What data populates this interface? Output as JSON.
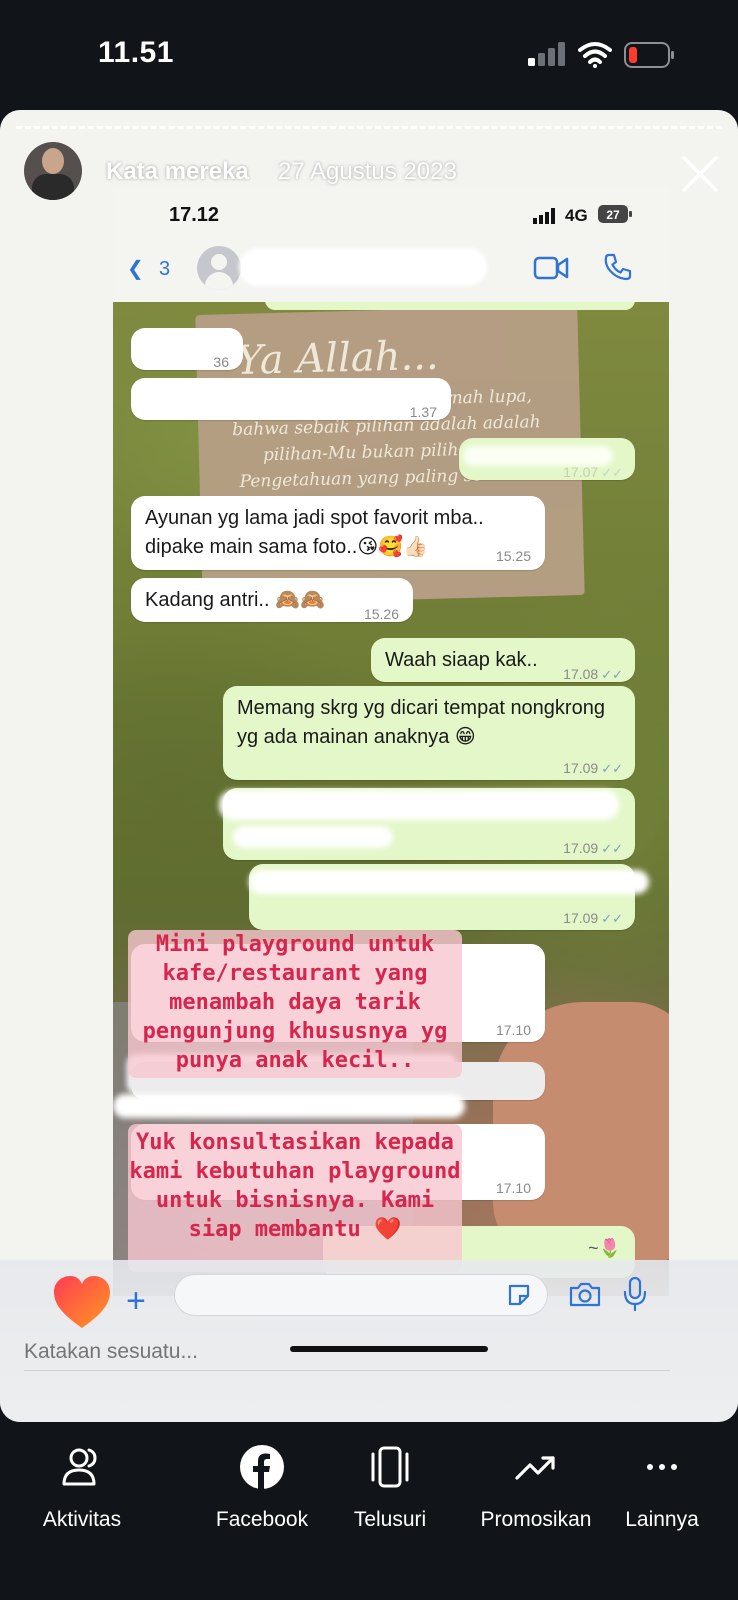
{
  "status_bar": {
    "time": "11.51"
  },
  "story": {
    "user": "Kata mereka",
    "date": "27 Agustus 2023",
    "close_icon": "close-icon"
  },
  "screenshot": {
    "status": {
      "time": "17.12",
      "network": "4G",
      "battery": "27"
    },
    "header": {
      "back_count": "3"
    },
    "wallpaper_text": {
      "title": "Ya Allah...",
      "lines": [
        "ernah lupa,",
        "bahwa sebaik pilihan adalah adalah",
        "pilihan-Mu bukan piliha",
        "Pengetahuan yang paling se"
      ]
    },
    "messages": [
      {
        "dir": "in",
        "text": "",
        "time": "36"
      },
      {
        "dir": "in",
        "text": "",
        "time": "1.37"
      },
      {
        "dir": "out",
        "text": "",
        "time": "17.07"
      },
      {
        "dir": "in",
        "text": "Ayunan yg lama jadi spot favorit mba.. dipake main sama foto..😘🥰👍🏻",
        "time": "15.25"
      },
      {
        "dir": "in",
        "text": "Kadang antri.. 🙈🙈",
        "time": "15.26"
      },
      {
        "dir": "out",
        "text": "Waah siaap kak..",
        "time": "17.08"
      },
      {
        "dir": "out",
        "text": "Memang skrg yg dicari tempat nongkrong yg ada mainan anaknya 😁",
        "time": "17.09"
      },
      {
        "dir": "out",
        "text": "",
        "time": "17.09"
      },
      {
        "dir": "out",
        "text": "",
        "time": "17.09"
      },
      {
        "dir": "in",
        "text": "",
        "time": "17.10"
      },
      {
        "dir": "in",
        "text": "",
        "time": "17.10"
      }
    ],
    "overlay": {
      "caption_1": "Mini playground untuk kafe/restaurant yang menambah daya tarik pengunjung khususnya yg punya anak kecil..",
      "caption_2": "Yuk konsultasikan kepada kami kebutuhan playground untuk bisnisnya. Kami siap membantu ❤️"
    },
    "last_emoji": "~🌷"
  },
  "reply_bar": {
    "placeholder": "Katakan sesuatu..."
  },
  "bottom_nav": [
    {
      "label": "Aktivitas",
      "icon": "activity-icon"
    },
    {
      "label": "Facebook",
      "icon": "facebook-icon"
    },
    {
      "label": "Telusuri",
      "icon": "browse-icon"
    },
    {
      "label": "Promosikan",
      "icon": "promote-icon"
    },
    {
      "label": "Lainnya",
      "icon": "more-icon"
    }
  ],
  "colors": {
    "accent": "#2e73d6",
    "overlay_text": "#d7264d",
    "out_bubble": "#e3f7c8",
    "heart": "#ff4f2e"
  }
}
